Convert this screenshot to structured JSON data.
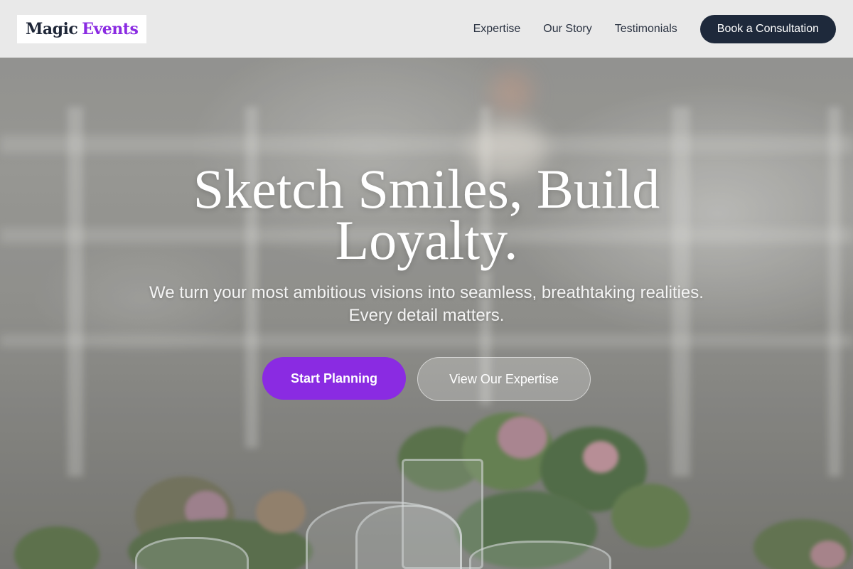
{
  "brand": {
    "name_part1": "Magic",
    "name_part2": "Events",
    "colors": {
      "dark": "#1e2637",
      "accent": "#8a2be2"
    }
  },
  "nav": {
    "links": [
      {
        "label": "Expertise"
      },
      {
        "label": "Our Story"
      },
      {
        "label": "Testimonials"
      }
    ],
    "cta_label": "Book a Consultation"
  },
  "hero": {
    "title": "Sketch Smiles, Build Loyalty.",
    "subtitle": "We turn your most ambitious visions into seamless, breathtaking realities. Every detail matters.",
    "primary_button": "Start Planning",
    "secondary_button": "View Our Expertise",
    "background_image": "blurred-wedding-table-with-flowers-and-glasses"
  },
  "theme": {
    "primary": "#8a2be2",
    "navy": "#1e293b",
    "header_bg": "#ececec"
  }
}
